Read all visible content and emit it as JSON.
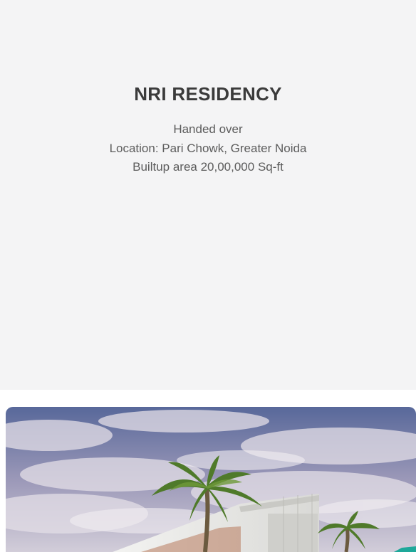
{
  "project": {
    "title": "NRI RESIDENCY",
    "status": "Handed over",
    "location": "Location: Pari Chowk, Greater Noida",
    "builtup_area": "Builtup area 20,00,000 Sq-ft"
  },
  "image": {
    "alt": "NRI RESIDENCY building render",
    "colors": {
      "sky_top": "#5c6f9c",
      "sky_bottom": "#c9c6d8",
      "palm": "#4f7a2a",
      "building": "#e9e9e6",
      "accent": "#1ea89a"
    }
  },
  "colors": {
    "card_bg": "#f4f4f5",
    "title": "#3b3b3b",
    "text": "#5c5c5c"
  }
}
